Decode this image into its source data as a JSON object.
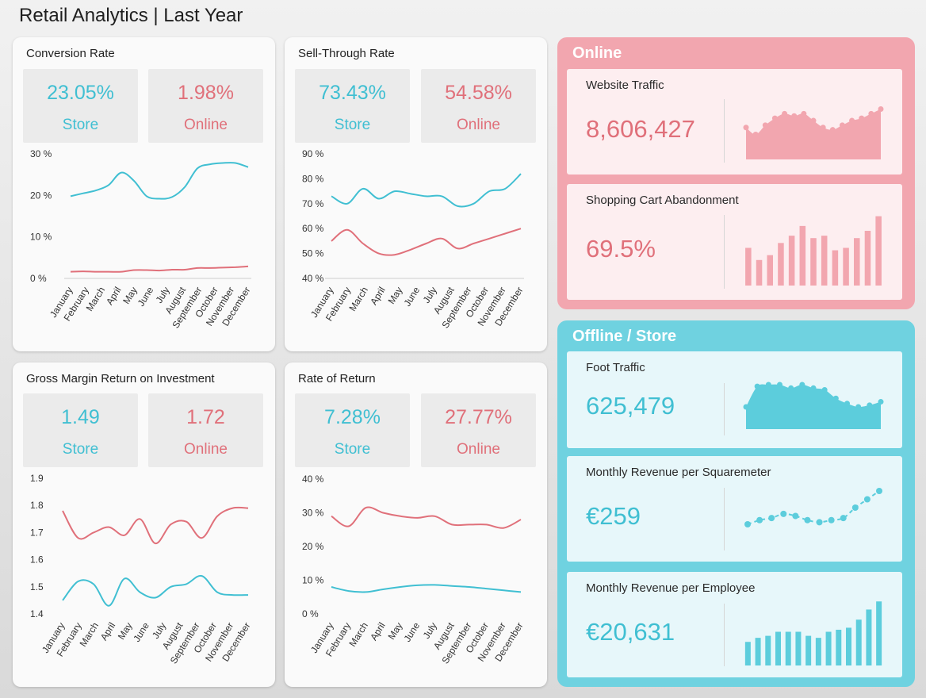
{
  "title": "Retail Analytics | Last Year",
  "colors": {
    "store": "#40bfd2",
    "online": "#e0707a",
    "online_panel": "#f2a6af",
    "store_panel": "#6fd2e0"
  },
  "months": [
    "January",
    "February",
    "March",
    "April",
    "May",
    "June",
    "July",
    "August",
    "September",
    "October",
    "November",
    "December"
  ],
  "cards": [
    {
      "title": "Conversion Rate",
      "store": {
        "value": "23.05%",
        "label": "Store"
      },
      "online": {
        "value": "1.98%",
        "label": "Online"
      },
      "chart": {
        "ticks": [
          "0 %",
          "10 %",
          "20 %",
          "30 %"
        ],
        "ymin": 0,
        "ymax": 30,
        "baseline": true,
        "store": [
          19.8,
          20.5,
          21.2,
          22.5,
          25.5,
          23.5,
          19.8,
          19.2,
          19.6,
          22,
          26.5,
          27.5,
          27.8,
          27.8,
          26.8
        ],
        "online": [
          1.6,
          1.7,
          1.6,
          1.6,
          1.6,
          2.0,
          2.0,
          1.9,
          2.1,
          2.1,
          2.5,
          2.5,
          2.6,
          2.7,
          2.9
        ]
      }
    },
    {
      "title": "Sell-Through Rate",
      "store": {
        "value": "73.43%",
        "label": "Store"
      },
      "online": {
        "value": "54.58%",
        "label": "Online"
      },
      "chart": {
        "ticks": [
          "40 %",
          "50 %",
          "60 %",
          "70 %",
          "80 %",
          "90 %"
        ],
        "ymin": 40,
        "ymax": 90,
        "baseline": true,
        "store": [
          73,
          70,
          76,
          72,
          75,
          74,
          73,
          73,
          69,
          70,
          75,
          76,
          82
        ],
        "online": [
          55,
          59.5,
          54,
          50,
          49.5,
          51.5,
          54,
          56,
          52,
          54,
          56,
          58,
          60
        ]
      }
    },
    {
      "title": "Gross Margin Return on Investment",
      "store": {
        "value": "1.49",
        "label": "Store"
      },
      "online": {
        "value": "1.72",
        "label": "Online"
      },
      "chart": {
        "ticks": [
          "1.4",
          "1.5",
          "1.6",
          "1.7",
          "1.8",
          "1.9"
        ],
        "ymin": 1.4,
        "ymax": 1.9,
        "baseline": false,
        "store": [
          1.45,
          1.52,
          1.51,
          1.43,
          1.53,
          1.48,
          1.46,
          1.5,
          1.51,
          1.54,
          1.48,
          1.47,
          1.47
        ],
        "online": [
          1.78,
          1.68,
          1.7,
          1.72,
          1.69,
          1.75,
          1.66,
          1.73,
          1.74,
          1.68,
          1.76,
          1.79,
          1.79
        ]
      }
    },
    {
      "title": "Rate of Return",
      "store": {
        "value": "7.28%",
        "label": "Store"
      },
      "online": {
        "value": "27.77%",
        "label": "Online"
      },
      "chart": {
        "ticks": [
          "0 %",
          "10 %",
          "20 %",
          "30 %",
          "40 %"
        ],
        "ymin": 0,
        "ymax": 40,
        "baseline": false,
        "store": [
          8,
          6.8,
          6.5,
          7.3,
          8.0,
          8.5,
          8.6,
          8.3,
          8.0,
          7.5,
          7.0,
          6.5
        ],
        "online": [
          29,
          26,
          31.5,
          30,
          29,
          28.5,
          29,
          26.5,
          26.5,
          26.5,
          25.5,
          28
        ]
      }
    }
  ],
  "online_panel": {
    "title": "Online",
    "items": [
      {
        "title": "Website Traffic",
        "value": "8,606,427",
        "spark": "area",
        "series": [
          47,
          44,
          48,
          51,
          53,
          52,
          53,
          50,
          47,
          46,
          48,
          50,
          51,
          53,
          55
        ]
      },
      {
        "title": "Shopping Cart Abandonment",
        "value": "69.5%",
        "spark": "bar",
        "series": [
          73,
          68,
          70,
          75,
          78,
          82,
          77,
          78,
          72,
          73,
          77,
          80,
          86
        ]
      }
    ]
  },
  "store_panel": {
    "title": "Offline / Store",
    "items": [
      {
        "title": "Foot Traffic",
        "value": "625,479",
        "spark": "area",
        "series": [
          51,
          63,
          64,
          64,
          62,
          64,
          62,
          61,
          56,
          53,
          51,
          52,
          54
        ]
      },
      {
        "title": "Monthly Revenue per Squaremeter",
        "value": "€259",
        "spark": "dots",
        "series": [
          254,
          256,
          257,
          259,
          258,
          256,
          255,
          256,
          257,
          262,
          266,
          270
        ]
      },
      {
        "title": "Monthly Revenue per Employee",
        "value": "€20,631",
        "spark": "bar",
        "series": [
          38,
          42,
          44,
          48,
          48,
          48,
          44,
          42,
          48,
          50,
          52,
          60,
          70,
          78
        ]
      }
    ]
  }
}
